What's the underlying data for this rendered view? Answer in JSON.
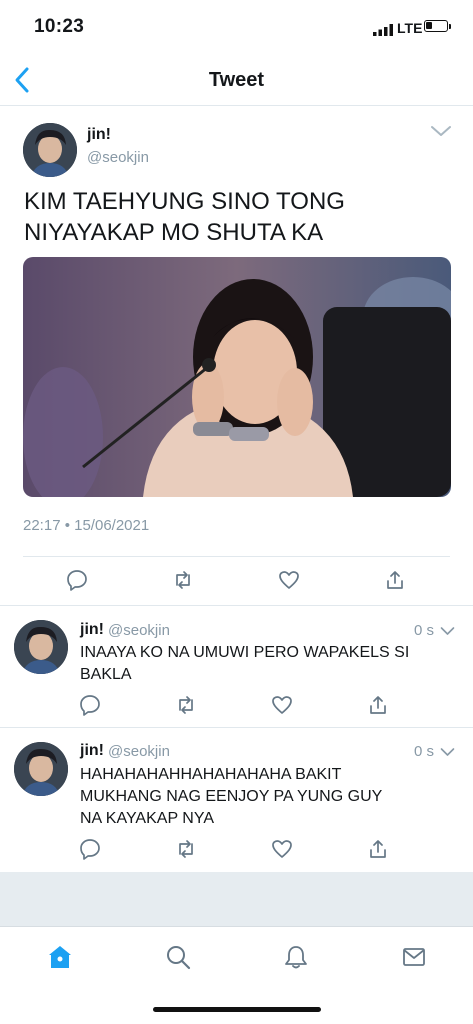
{
  "status_bar": {
    "time": "10:23",
    "network": "LTE"
  },
  "nav": {
    "title": "Tweet",
    "back_icon": "chevron-left-icon"
  },
  "main_tweet": {
    "name": "jin!",
    "handle": "@seokjin",
    "text": "KIM TAEHYUNG SINO TONG NIYAYAKAP MO SHUTA KA",
    "timestamp": "22:17 • 15/06/2021"
  },
  "replies": [
    {
      "name": "jin!",
      "handle": "@seokjin",
      "time": "0 s",
      "text": "INAAYA KO NA UMUWI PERO WAPAKELS SI BAKLA"
    },
    {
      "name": "jin!",
      "handle": "@seokjin",
      "time": "0 s",
      "text": "HAHAHAHAHHAHAHAHAHA BAKIT MUKHANG NAG EENJOY PA YUNG GUY NA KAYAKAP NYA"
    }
  ],
  "colors": {
    "accent": "#1da1f2",
    "secondary_text": "#8899a6",
    "divider": "#e1e8ed"
  },
  "tabs": [
    "home-icon",
    "search-icon",
    "bell-icon",
    "mail-icon"
  ]
}
